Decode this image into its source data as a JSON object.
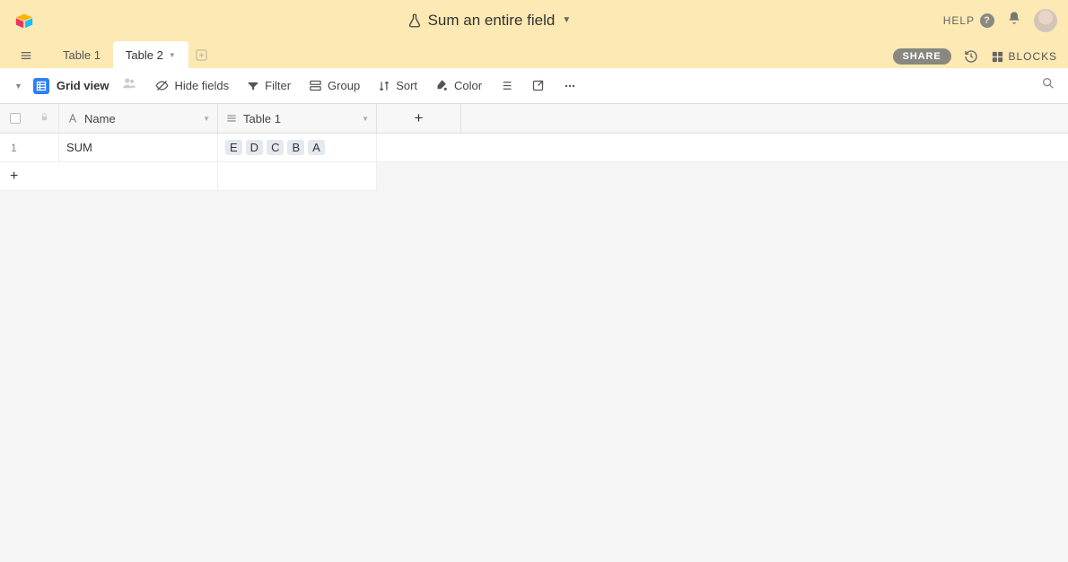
{
  "header": {
    "title": "Sum an entire field",
    "help_label": "HELP"
  },
  "tabs": {
    "items": [
      {
        "label": "Table 1",
        "active": false
      },
      {
        "label": "Table 2",
        "active": true
      }
    ],
    "share_label": "SHARE",
    "blocks_label": "BLOCKS"
  },
  "toolbar": {
    "view_name": "Grid view",
    "hide_fields": "Hide fields",
    "filter": "Filter",
    "group": "Group",
    "sort": "Sort",
    "color": "Color"
  },
  "columns": [
    {
      "name": "Name",
      "icon": "text"
    },
    {
      "name": "Table 1",
      "icon": "link"
    }
  ],
  "rows": [
    {
      "num": "1",
      "name": "SUM",
      "linked": [
        "E",
        "D",
        "C",
        "B",
        "A"
      ]
    }
  ]
}
